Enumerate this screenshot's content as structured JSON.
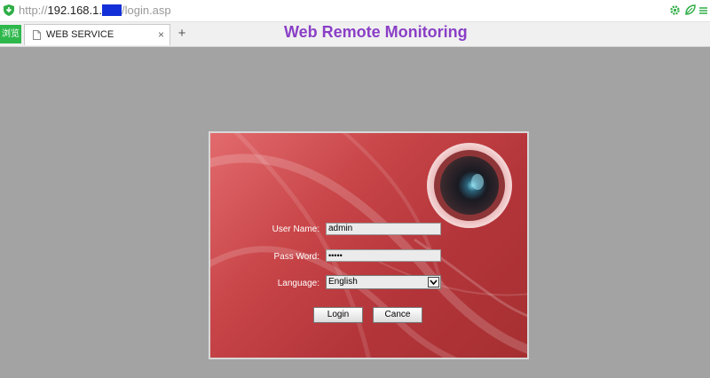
{
  "browser": {
    "url_scheme": "http://",
    "url_host": "192.168.1.",
    "url_masked": "██",
    "url_path": "/login.asp",
    "left_tab_label": "浏览",
    "tab_title": "WEB SERVICE",
    "tab_close": "×",
    "new_tab": "+"
  },
  "page": {
    "title": "Web Remote Monitoring"
  },
  "login": {
    "username_label": "User Name:",
    "username_value": "admin",
    "password_label": "Pass Word:",
    "password_display": "•••••",
    "language_label": "Language:",
    "language_value": "English",
    "login_button": "Login",
    "cancel_button": "Cance"
  },
  "colors": {
    "panel_red": "#b3353a",
    "title_purple": "#8a3fc6",
    "tab_green": "#2eb84c",
    "background": "#a3a3a3"
  },
  "icons": {
    "security": "shield-icon",
    "page": "page-icon",
    "extensions": [
      "gear-icon",
      "leaf-icon"
    ],
    "decoration": "camera-lens-icon",
    "dropdown": "chevron-down-icon"
  }
}
